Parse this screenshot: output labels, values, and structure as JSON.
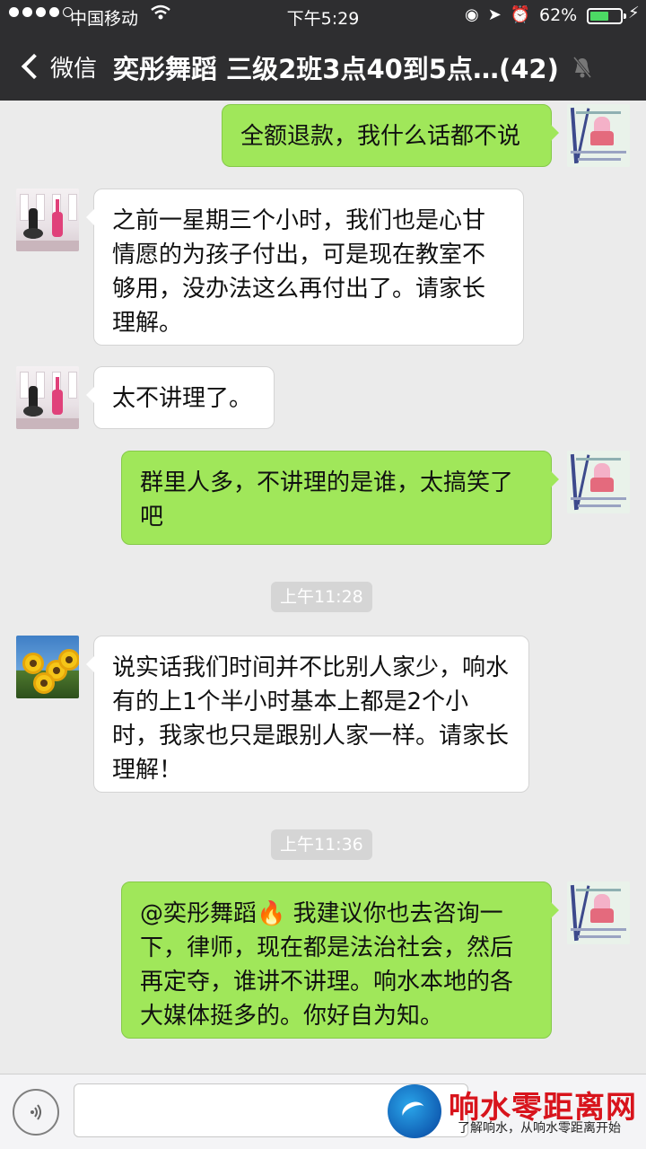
{
  "status_bar": {
    "carrier": "中国移动",
    "time": "下午5:29",
    "battery_percent": "62%",
    "battery_level": 0.62
  },
  "nav": {
    "back_label": "微信",
    "title": "奕彤舞蹈 三级2班3点40到5点…(42)"
  },
  "messages": [
    {
      "side": "out",
      "avatar": "peppa-pig-avatar",
      "text": "全额退款，我什么话都不说"
    },
    {
      "side": "in",
      "avatar": "ballet-dancers-avatar",
      "text": "之前一星期三个小时，我们也是心甘情愿的为孩子付出，可是现在教室不够用，没办法这么再付出了。请家长理解。"
    },
    {
      "side": "in",
      "avatar": "ballet-dancers-avatar",
      "text": "太不讲理了。"
    },
    {
      "side": "out",
      "avatar": "peppa-pig-avatar",
      "text": "群里人多，不讲理的是谁，太搞笑了吧"
    },
    {
      "side": "in",
      "avatar": "sunflowers-avatar",
      "text": "说实话我们时间并不比别人家少，响水有的上1个半小时基本上都是2个小时，我家也只是跟别人家一样。请家长理解！"
    },
    {
      "side": "out",
      "avatar": "peppa-pig-avatar",
      "text": "@奕彤舞蹈🔥 我建议你也去咨询一下，律师，现在都是法治社会，然后再定夺，谁讲不讲理。响水本地的各大媒体挺多的。你好自为知。"
    }
  ],
  "timestamps": [
    "上午11:28",
    "上午11:36"
  ],
  "watermark": {
    "name": "响水零距离网",
    "slogan": "了解响水，从响水零距离开始"
  },
  "colors": {
    "nav_bg": "#2e2e30",
    "chat_bg": "#ebebeb",
    "outgoing_bubble": "#a0e75a",
    "incoming_bubble": "#ffffff",
    "watermark_red": "#d8141c"
  }
}
